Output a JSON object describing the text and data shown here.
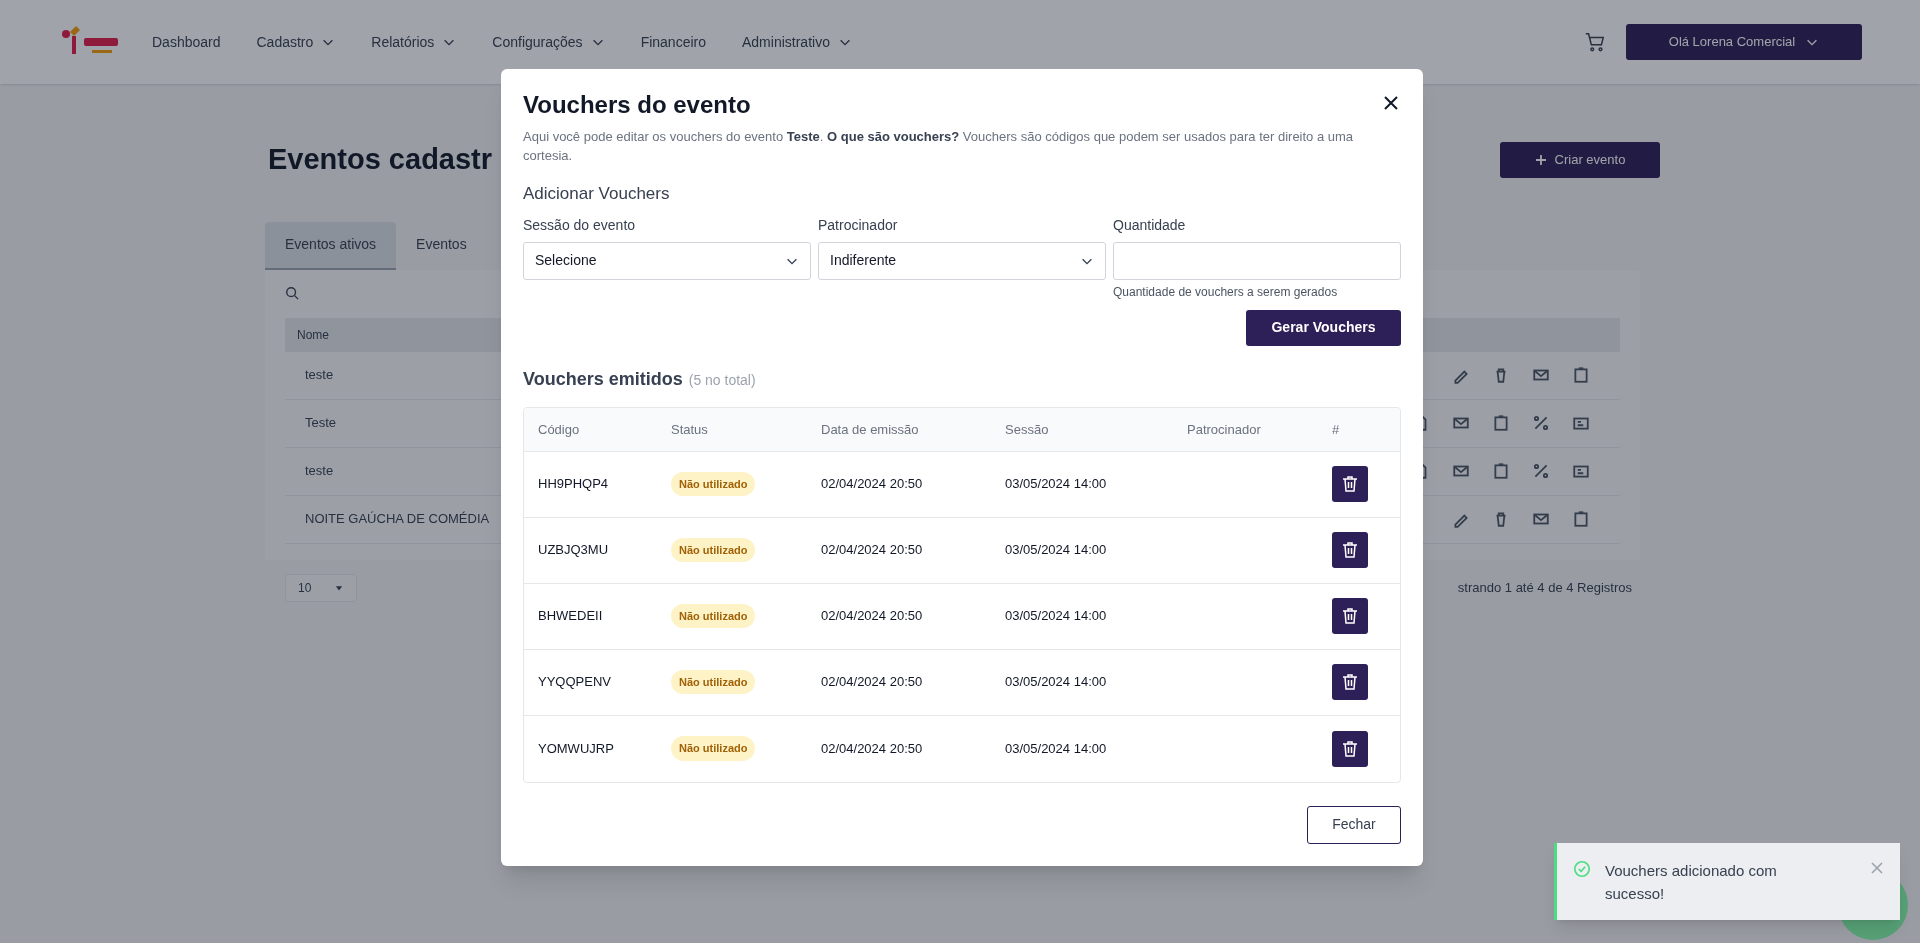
{
  "navbar": {
    "items": [
      {
        "label": "Dashboard",
        "dropdown": false
      },
      {
        "label": "Cadastro",
        "dropdown": true
      },
      {
        "label": "Relatórios",
        "dropdown": true
      },
      {
        "label": "Configurações",
        "dropdown": true
      },
      {
        "label": "Financeiro",
        "dropdown": false
      },
      {
        "label": "Administrativo",
        "dropdown": true
      }
    ],
    "user_button": "Olá Lorena Comercial"
  },
  "page": {
    "title": "Eventos cadastr",
    "create_button": "Criar evento",
    "tabs": [
      {
        "label": "Eventos ativos",
        "selected": true
      },
      {
        "label": "Eventos",
        "selected": false
      }
    ],
    "table": {
      "columns": [
        "Nome"
      ],
      "rows": [
        {
          "name": "teste"
        },
        {
          "name": "Teste"
        },
        {
          "name": "teste"
        },
        {
          "name": "NOITE GAÚCHA DE COMÉDIA"
        }
      ]
    },
    "page_size": "10",
    "footer": "strando 1 até 4 de 4 Registros"
  },
  "modal": {
    "title": "Vouchers do evento",
    "description": "Aqui você pode editar os vouchers do evento **Teste**. **O que são vouchers?** Vouchers são códigos que podem ser usados para ter direito a uma cortesia.",
    "add_heading": "Adicionar Vouchers",
    "fields": [
      {
        "kind": "select",
        "label": "Sessão do evento",
        "value": "Selecione"
      },
      {
        "kind": "select",
        "label": "Patrocinador",
        "value": "Indiferente"
      },
      {
        "kind": "input",
        "label": "Quantidade",
        "help": "Quantidade de vouchers a serem gerados"
      }
    ],
    "generate_button": "Gerar Vouchers",
    "list_heading": "Vouchers emitidos",
    "list_count": "(5 no total)",
    "table": {
      "columns": [
        "Código",
        "Status",
        "Data de emissão",
        "Sessão",
        "Patrocinador",
        "#"
      ],
      "rows": [
        {
          "code": "HH9PHQP4",
          "status": "Não utilizado",
          "issued": "02/04/2024 20:50",
          "session": "03/05/2024 14:00"
        },
        {
          "code": "UZBJQ3MU",
          "status": "Não utilizado",
          "issued": "02/04/2024 20:50",
          "session": "03/05/2024 14:00"
        },
        {
          "code": "BHWEDEII",
          "status": "Não utilizado",
          "issued": "02/04/2024 20:50",
          "session": "03/05/2024 14:00"
        },
        {
          "code": "YYQQPENV",
          "status": "Não utilizado",
          "issued": "02/04/2024 20:50",
          "session": "03/05/2024 14:00"
        },
        {
          "code": "YOMWUJRP",
          "status": "Não utilizado",
          "issued": "02/04/2024 20:50",
          "session": "03/05/2024 14:00"
        }
      ]
    },
    "close_button": "Fechar"
  },
  "toast": {
    "message": "Vouchers adicionado com sucesso!"
  }
}
